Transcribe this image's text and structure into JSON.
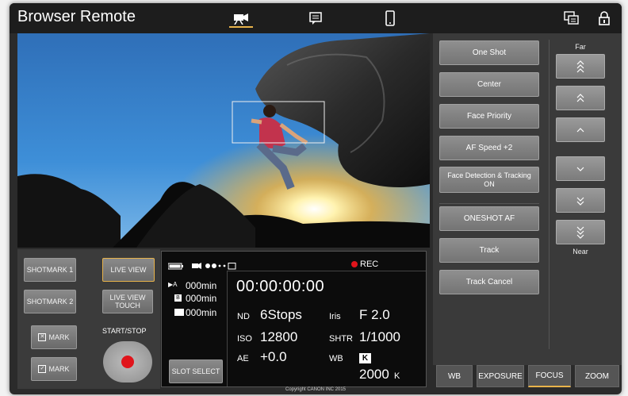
{
  "app": {
    "title": "Browser Remote"
  },
  "header_icons": [
    "camera-icon",
    "message-icon",
    "smartphone-icon",
    "settings-window-icon",
    "lock-icon"
  ],
  "controls": {
    "shotmark1": "SHOTMARK 1",
    "shotmark2": "SHOTMARK 2",
    "x_mark": "MARK",
    "check_mark": "MARK",
    "live_view": "LIVE VIEW",
    "live_view_touch": "LIVE VIEW TOUCH",
    "start_stop": "START/STOP"
  },
  "status": {
    "rec_label": "REC",
    "slot_a_remaining": "000min",
    "slot_b_remaining": "000min",
    "slot_c_remaining": "000min",
    "slot_select": "SLOT SELECT",
    "timecode": "00:00:00:00",
    "nd_label": "ND",
    "nd_value": "6Stops",
    "iris_label": "Iris",
    "iris_value": "F 2.0",
    "iso_label": "ISO",
    "iso_value": "12800",
    "shtr_label": "SHTR",
    "shtr_value": "1/1000",
    "ae_label": "AE",
    "ae_value": "+0.0",
    "wb_label": "WB",
    "wb_mode": "K",
    "wb_value": "2000",
    "wb_unit": "K"
  },
  "focus": {
    "one_shot": "One Shot",
    "center": "Center",
    "face_priority": "Face Priority",
    "af_speed": "AF Speed +2",
    "face_detection": "Face Detection & Tracking ON",
    "oneshot_af": "ONESHOT AF",
    "track": "Track",
    "track_cancel": "Track Cancel",
    "far_label": "Far",
    "near_label": "Near"
  },
  "tabs": [
    {
      "label": "WB"
    },
    {
      "label": "EXPOSURE"
    },
    {
      "label": "FOCUS"
    },
    {
      "label": "ZOOM"
    }
  ],
  "active_tab": "FOCUS",
  "colors": {
    "accent": "#e8b34a",
    "record": "#e0141b"
  },
  "footer": "Copyright CANON INC 2015"
}
